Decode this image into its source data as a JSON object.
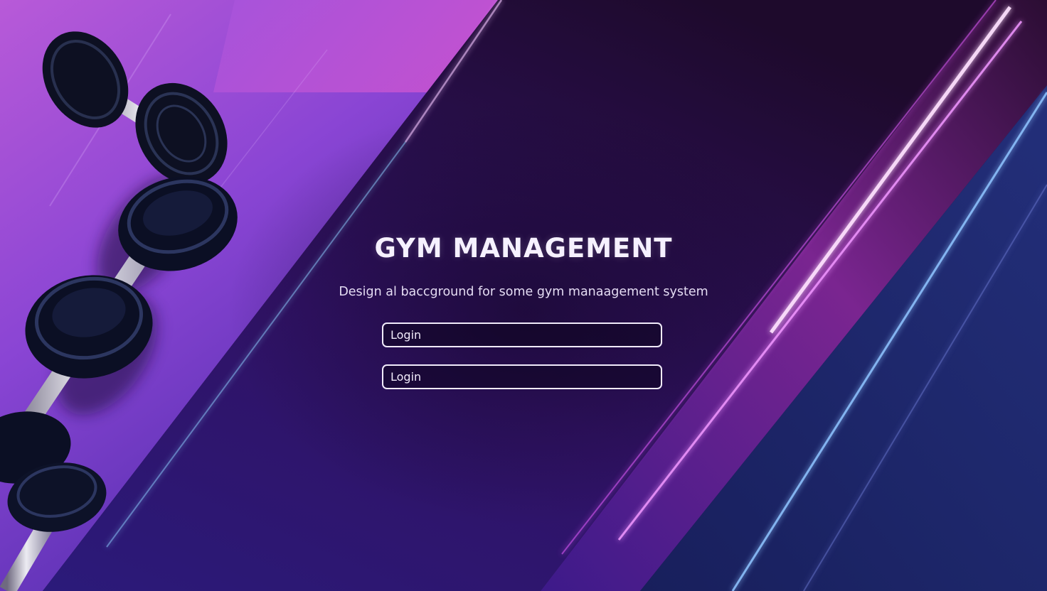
{
  "title": "GYM MANAGEMENT",
  "subtitle": "Design al baccground for some gym manaagement system",
  "login_fields": [
    {
      "placeholder": "Login",
      "value": ""
    },
    {
      "placeholder": "Login",
      "value": ""
    }
  ],
  "background": {
    "image": "dumbbell-rack",
    "colors": {
      "purple_light": "#c455d6",
      "purple_mid": "#6e35c4",
      "indigo_dark": "#231045",
      "neon_magenta": "#e077ff",
      "neon_blue": "#7fb5ff",
      "navy": "#1f2568"
    }
  }
}
